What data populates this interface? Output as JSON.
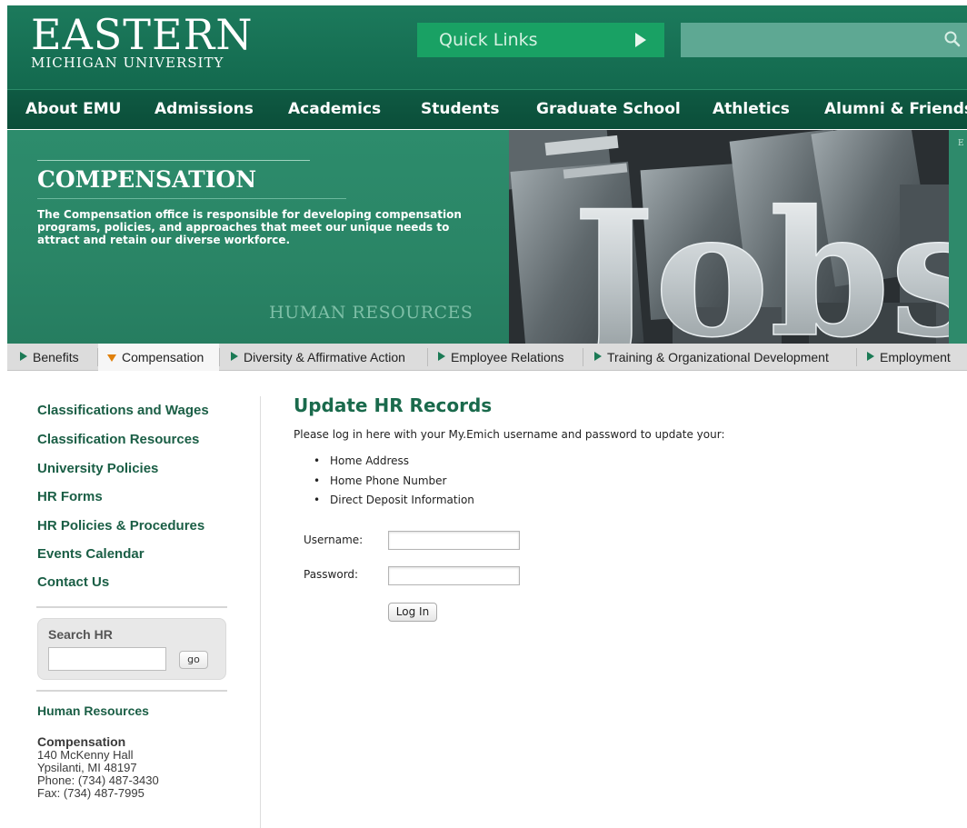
{
  "header": {
    "logo_main": "EASTERN",
    "logo_sub": "MICHIGAN UNIVERSITY",
    "quick_links_label": "Quick Links",
    "search_placeholder": ""
  },
  "nav": {
    "items": [
      {
        "label": "About EMU"
      },
      {
        "label": "Admissions"
      },
      {
        "label": "Academics"
      },
      {
        "label": "Students"
      },
      {
        "label": "Graduate School"
      },
      {
        "label": "Athletics"
      },
      {
        "label": "Alumni & Friends"
      }
    ]
  },
  "banner": {
    "title": "COMPENSATION",
    "description": "The Compensation office is responsible for developing compensation programs, policies, and approaches that meet our unique needs to attract and retain our diverse workforce.",
    "department": "HUMAN RESOURCES",
    "photo_text": "Jobs",
    "edge_letter": "E"
  },
  "tabs": [
    {
      "label": "Benefits",
      "active": false
    },
    {
      "label": "Compensation",
      "active": true
    },
    {
      "label": "Diversity & Affirmative Action",
      "active": false
    },
    {
      "label": "Employee Relations",
      "active": false
    },
    {
      "label": "Training & Organizational Development",
      "active": false
    },
    {
      "label": "Employment",
      "active": false
    }
  ],
  "sidebar": {
    "links": [
      {
        "label": "Classifications and Wages"
      },
      {
        "label": "Classification Resources"
      },
      {
        "label": "University Policies"
      },
      {
        "label": "HR Forms"
      },
      {
        "label": "HR Policies & Procedures"
      },
      {
        "label": "Events Calendar"
      },
      {
        "label": "Contact Us"
      }
    ],
    "search_label": "Search HR",
    "go_label": "go",
    "hr_title": "Human Resources",
    "address": {
      "heading": "Compensation",
      "line1": "140 McKenny Hall",
      "line2": "Ypsilanti, MI  48197",
      "phone": "Phone:  (734) 487-3430",
      "fax": "Fax:  (734) 487-7995"
    }
  },
  "main": {
    "title": "Update HR Records",
    "intro": "Please log in here with your My.Emich username and password to update your:",
    "bullets": [
      "Home Address",
      "Home Phone Number",
      "Direct Deposit Information"
    ],
    "username_label": "Username:",
    "password_label": "Password:",
    "login_label": "Log In"
  },
  "colors": {
    "brand_green": "#13694e",
    "nav_green": "#0b4e39",
    "quick_links": "#19a164",
    "link_green": "#1a5e45",
    "active_tab_marker": "#e0800a"
  }
}
